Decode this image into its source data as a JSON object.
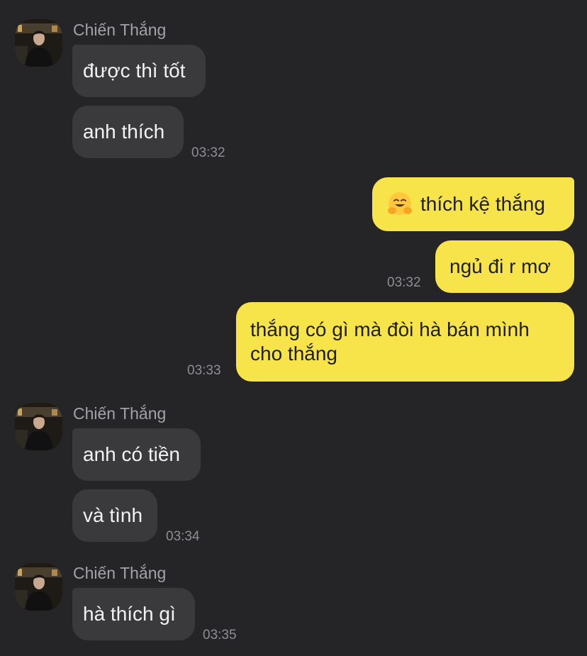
{
  "sender_name": "Chiến Thắng",
  "groups": [
    {
      "messages": [
        "được thì tốt",
        "anh thích"
      ],
      "time": "03:32"
    },
    {
      "messages": [
        "anh có tiền",
        "và tình"
      ],
      "time": "03:34"
    },
    {
      "messages": [
        "hà thích gì"
      ],
      "time": "03:35"
    }
  ],
  "outgoing": [
    {
      "emoji": "hugging-face-emoji",
      "text": "thích kệ thắng"
    },
    {
      "text": "ngủ đi r mơ",
      "time": "03:32"
    },
    {
      "text": "thắng có gì mà đòi hà bán mình cho thắng",
      "time": "03:33"
    }
  ],
  "colors": {
    "background": "#252528",
    "incoming_bubble": "#3a3a3d",
    "outgoing_bubble": "#f7e34a",
    "sender_text": "#a2a2a7",
    "time_text": "#8e8e92"
  }
}
